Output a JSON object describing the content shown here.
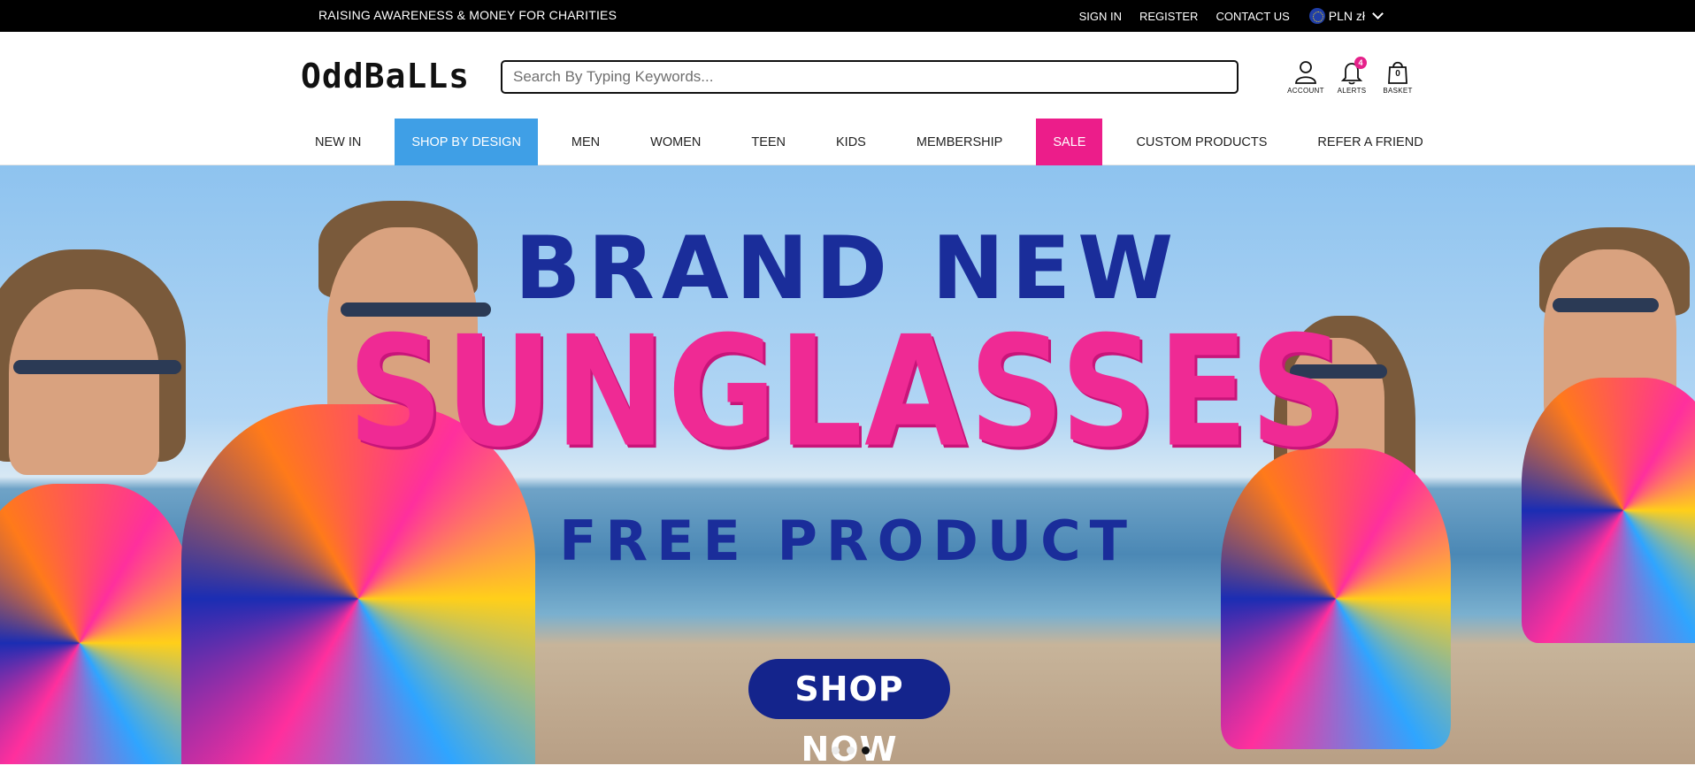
{
  "topbar": {
    "tagline": "RAISING AWARENESS & MONEY FOR CHARITIES",
    "links": [
      "SIGN IN",
      "REGISTER",
      "CONTACT US"
    ],
    "currency": "PLN zł"
  },
  "header": {
    "logo": "OddBaLLs",
    "search_placeholder": "Search By Typing Keywords...",
    "icons": {
      "account_label": "ACCOUNT",
      "alerts_label": "ALERTS",
      "alerts_count": "4",
      "basket_label": "BASKET",
      "basket_count": "0"
    }
  },
  "nav": {
    "items": [
      "NEW IN",
      "SHOP BY DESIGN",
      "MEN",
      "WOMEN",
      "TEEN",
      "KIDS",
      "MEMBERSHIP",
      "SALE",
      "CUSTOM PRODUCTS",
      "REFER A FRIEND"
    ],
    "active": "SHOP BY DESIGN",
    "sale_color": "#ec1d8a",
    "active_color": "#3f9fe6"
  },
  "hero": {
    "line1": "BRAND NEW",
    "line2": "SUNGLASSES",
    "line3": "FREE PRODUCT",
    "cta": "SHOP NOW",
    "slides_total": 3,
    "slide_active": 3,
    "colors": {
      "navy": "#1a2d9a",
      "pink": "#ef2a94"
    }
  }
}
